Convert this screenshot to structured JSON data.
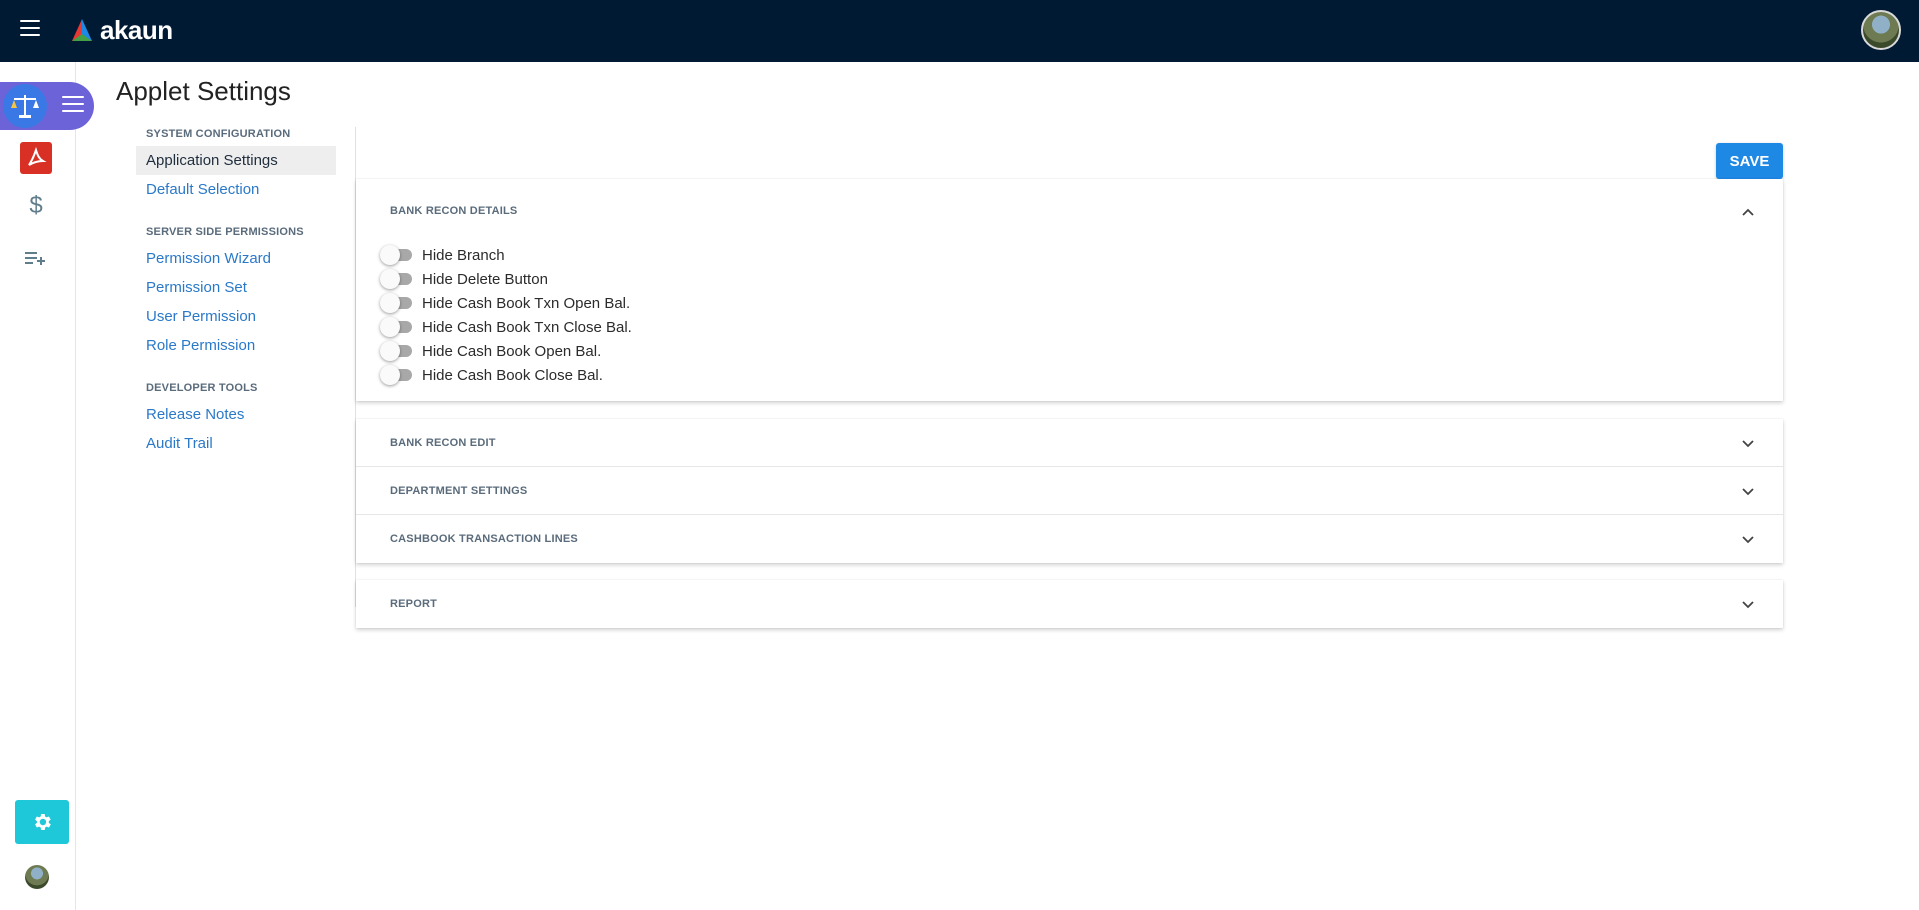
{
  "header": {
    "logo_text": "akaun",
    "menu_icon": "hamburger-icon",
    "avatar": "user-avatar"
  },
  "rail": {
    "active_app_icon": "scales-icon",
    "icons": [
      "pdf-icon",
      "dollar-icon",
      "playlist-add-icon",
      "gear-icon",
      "avatar"
    ],
    "settings_color": "#1ec8d8"
  },
  "page": {
    "title": "Applet Settings"
  },
  "nav": {
    "system_configuration": {
      "heading": "SYSTEM CONFIGURATION",
      "items": [
        "Application Settings",
        "Default Selection"
      ]
    },
    "server_side_permissions": {
      "heading": "SERVER SIDE PERMISSIONS",
      "items": [
        "Permission Wizard",
        "Permission Set",
        "User Permission",
        "Role Permission"
      ]
    },
    "developer_tools": {
      "heading": "DEVELOPER TOOLS",
      "items": [
        "Release Notes",
        "Audit Trail"
      ]
    },
    "active_item": "Application Settings"
  },
  "actions": {
    "save_label": "SAVE",
    "save_color": "#1e88e5"
  },
  "panels": {
    "bank_recon_details": {
      "title": "BANK RECON DETAILS",
      "expanded": true,
      "toggles": [
        {
          "label": "Hide Branch",
          "on": false
        },
        {
          "label": "Hide Delete Button",
          "on": false
        },
        {
          "label": "Hide Cash Book Txn Open Bal.",
          "on": false
        },
        {
          "label": "Hide Cash Book Txn Close Bal.",
          "on": false
        },
        {
          "label": "Hide Cash Book Open Bal.",
          "on": false
        },
        {
          "label": "Hide Cash Book Close Bal.",
          "on": false
        }
      ]
    },
    "group": [
      {
        "title": "BANK RECON EDIT",
        "expanded": false
      },
      {
        "title": "DEPARTMENT SETTINGS",
        "expanded": false
      },
      {
        "title": "CASHBOOK TRANSACTION LINES",
        "expanded": false
      }
    ],
    "report": {
      "title": "REPORT",
      "expanded": false
    }
  }
}
